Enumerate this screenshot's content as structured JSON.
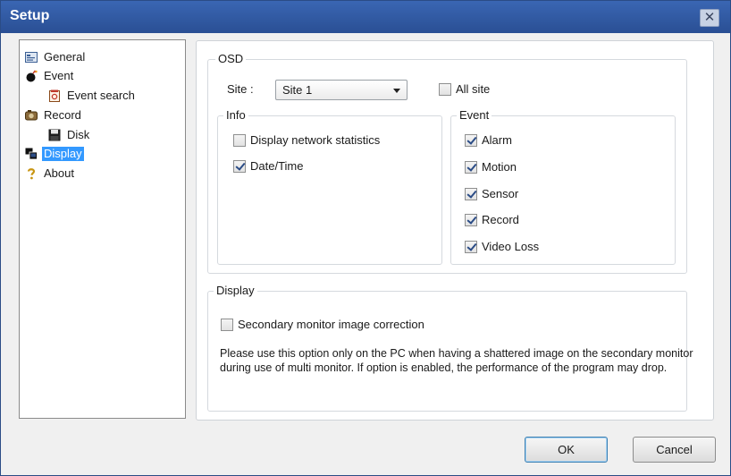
{
  "window": {
    "title": "Setup",
    "close_glyph": "✕"
  },
  "tree": {
    "items": [
      {
        "label": "General",
        "icon": "general-icon"
      },
      {
        "label": "Event",
        "icon": "event-icon"
      },
      {
        "label": "Event search",
        "icon": "event-search-icon"
      },
      {
        "label": "Record",
        "icon": "record-icon"
      },
      {
        "label": "Disk",
        "icon": "disk-icon"
      },
      {
        "label": "Display",
        "icon": "display-icon",
        "selected": true
      },
      {
        "label": "About",
        "icon": "about-icon"
      }
    ]
  },
  "osd": {
    "title": "OSD",
    "site_label": "Site :",
    "site_value": "Site 1",
    "all_site": {
      "label": "All site",
      "checked": false
    },
    "info": {
      "title": "Info",
      "display_network_statistics": {
        "label": "Display network statistics",
        "checked": false
      },
      "date_time": {
        "label": "Date/Time",
        "checked": true
      }
    },
    "event": {
      "title": "Event",
      "alarm": {
        "label": "Alarm",
        "checked": true
      },
      "motion": {
        "label": "Motion",
        "checked": true
      },
      "sensor": {
        "label": "Sensor",
        "checked": true
      },
      "record": {
        "label": "Record",
        "checked": true
      },
      "video_loss": {
        "label": "Video Loss",
        "checked": true
      }
    }
  },
  "display": {
    "title": "Display",
    "secondary_monitor": {
      "label": "Secondary monitor image correction",
      "checked": false
    },
    "note": "Please use this option only on the PC when having a shattered image on the secondary monitor during use of multi monitor. If option is enabled, the performance of the program may drop."
  },
  "buttons": {
    "ok": "OK",
    "cancel": "Cancel"
  }
}
